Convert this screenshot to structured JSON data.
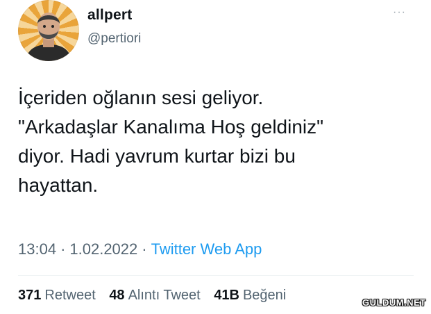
{
  "author": {
    "display_name": "allpert",
    "handle": "@pertiori",
    "avatar_icon": "profile-photo"
  },
  "more_icon": "ellipsis-icon",
  "more_label": "···",
  "tweet": {
    "text": "İçeriden oğlanın sesi geliyor.\n\"Arkadaşlar Kanalıma Hoş geldiniz\"\ndiyor. Hadi yavrum kurtar bizi bu\nhayattan."
  },
  "meta": {
    "time": "13:04",
    "separator": "·",
    "date": "1.02.2022",
    "source": "Twitter Web App"
  },
  "stats": {
    "retweets": {
      "count": "371",
      "label": "Retweet"
    },
    "quotes": {
      "count": "48",
      "label": "Alıntı Tweet"
    },
    "likes": {
      "count": "41B",
      "label": "Beğeni"
    }
  },
  "watermark": "GULDUM.NET",
  "colors": {
    "link": "#1d9bf0",
    "secondary_text": "#536471",
    "primary_text": "#0f1419",
    "avatar_ray_1": "#e9a43a",
    "avatar_ray_2": "#f6d69a"
  }
}
